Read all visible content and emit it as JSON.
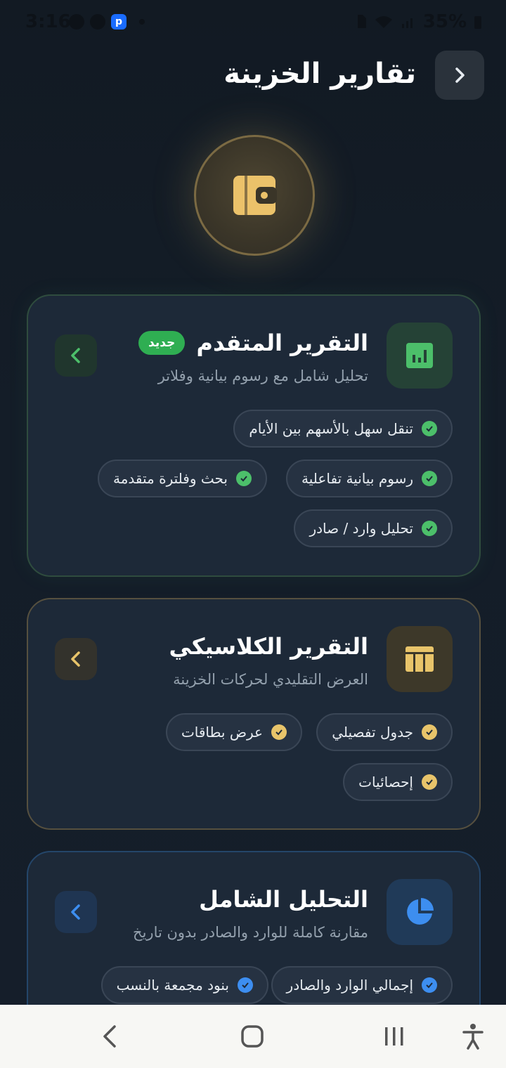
{
  "status_bar": {
    "time": "3:16",
    "battery": "35%",
    "icons": [
      "whatsapp-icon",
      "messenger-icon",
      "p-app-icon",
      "dot-icon",
      "sim-icon",
      "wifi-icon",
      "signal-icon",
      "battery-icon"
    ]
  },
  "header": {
    "title": "تقارير الخزينة",
    "back_icon": "chevron-right-icon"
  },
  "hero": {
    "icon": "wallet-icon"
  },
  "cards": [
    {
      "title": "التقرير المتقدم",
      "badge": "جديد",
      "subtitle": "تحليل شامل مع رسوم بيانية وفلاتر",
      "icon": "bar-chart-icon",
      "color": "#4cbf6a",
      "features": [
        "تنقل سهل بالأسهم بين الأيام",
        "رسوم بيانية تفاعلية",
        "بحث وفلترة متقدمة",
        "تحليل وارد / صادر"
      ]
    },
    {
      "title": "التقرير الكلاسيكي",
      "subtitle": "العرض التقليدي لحركات الخزينة",
      "icon": "table-icon",
      "color": "#e8c46a",
      "features": [
        "جدول تفصيلي",
        "عرض بطاقات",
        "إحصائيات"
      ]
    },
    {
      "title": "التحليل الشامل",
      "subtitle": "مقارنة كاملة للوارد والصادر بدون تاريخ",
      "icon": "pie-chart-icon",
      "color": "#3d8ef0",
      "features": [
        "إجمالي الوارد والصادر",
        "بنود مجمعة بالنسب"
      ]
    }
  ],
  "nav_bar": {
    "buttons": [
      "back-nav-icon",
      "home-nav-icon",
      "recents-nav-icon",
      "accessibility-icon"
    ]
  }
}
